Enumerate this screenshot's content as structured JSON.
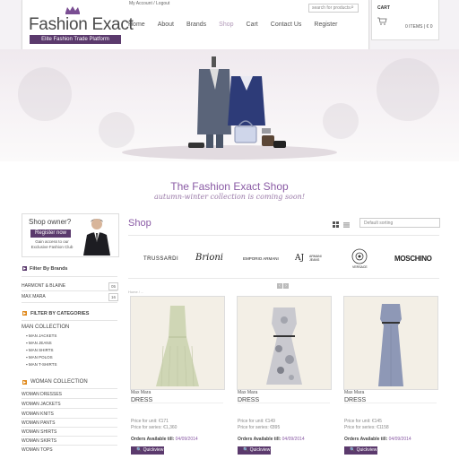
{
  "header": {
    "logo_title": "Fashion Exact",
    "tagline": "Elite Fashion Trade Platform",
    "account_links": "My Account / Logout",
    "search_placeholder": "search for products",
    "nav": [
      "Home",
      "About",
      "Brands",
      "Shop",
      "Cart",
      "Contact Us",
      "Register"
    ],
    "active_nav": "Shop",
    "cart_label": "CART",
    "cart_count": "0 ITEMS | € 0"
  },
  "hero": {
    "title": "The Fashion Exact Shop",
    "subtitle": "autumn-winter collection is coming soon!"
  },
  "sidebar": {
    "owner_title": "Shop owner?",
    "register_label": "Register now",
    "owner_text": "Gain access to our Exclusive Fashion Club",
    "brands_heading": "Filter By Brands",
    "brands": [
      {
        "label": "HARMONT & BLAINE",
        "count": "05"
      },
      {
        "label": "MAX MARA",
        "count": "16"
      }
    ],
    "categories_heading": "FILTER BY CATEGORIES",
    "man_heading": "MAN COLLECTION",
    "man_items": [
      "MAN JACKETS",
      "MAN JEANS",
      "MAN SHIRTS",
      "MAN POLOS",
      "MAN T-SHIRTS"
    ],
    "woman_heading": "WOMAN COLLECTION",
    "woman_items": [
      "WOMAN DRESSES",
      "WOMAN JACKETS",
      "WOMAN KNITS",
      "WOMAN PANTS",
      "WOMAN SHIRTS",
      "WOMAN SKIRTS",
      "WOMAN TOPS"
    ]
  },
  "main": {
    "heading": "Shop",
    "sort_label": "Default sorting",
    "breadcrumb": "Home / ...",
    "brands": [
      "TRUSSARDI",
      "Brioni",
      "EMPORIO ARMANI",
      "AJ",
      "ARMANI JEANS",
      "VERSACE",
      "MOSCHINO"
    ],
    "products": [
      {
        "brand": "Max Mara",
        "name": "DRESS",
        "unit": "Price for unit: €171",
        "series": "Price for series: €1,360",
        "order_label": "Orders Available till:",
        "order_date": "04/09/2014",
        "quickview": "Quickview",
        "color": "#cfd6b5"
      },
      {
        "brand": "Max Mara",
        "name": "DRESS",
        "unit": "Price for unit: €149",
        "series": "Price for series: €895",
        "order_label": "Orders Available till:",
        "order_date": "04/09/2014",
        "quickview": "Quickview",
        "color": "#c9c9cf"
      },
      {
        "brand": "Max Mara",
        "name": "DRESS",
        "unit": "Price for unit: €145",
        "series": "Price for series: €1158",
        "order_label": "Orders Available till:",
        "order_date": "04/09/2014",
        "quickview": "Quickview",
        "color": "#8e98b6"
      }
    ]
  }
}
